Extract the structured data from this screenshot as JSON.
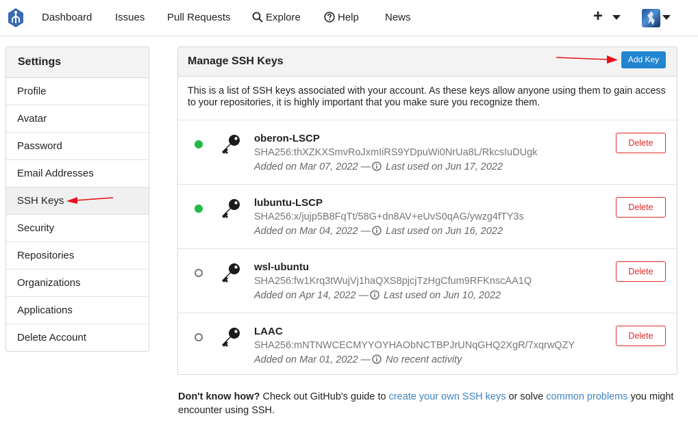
{
  "nav": {
    "items": [
      {
        "label": "Dashboard"
      },
      {
        "label": "Issues"
      },
      {
        "label": "Pull Requests"
      },
      {
        "label": "Explore"
      },
      {
        "label": "Help"
      },
      {
        "label": "News"
      }
    ],
    "plus_label": "+"
  },
  "sidebar": {
    "title": "Settings",
    "items": [
      {
        "label": "Profile"
      },
      {
        "label": "Avatar"
      },
      {
        "label": "Password"
      },
      {
        "label": "Email Addresses"
      },
      {
        "label": "SSH Keys",
        "active": true
      },
      {
        "label": "Security"
      },
      {
        "label": "Repositories"
      },
      {
        "label": "Organizations"
      },
      {
        "label": "Applications"
      },
      {
        "label": "Delete Account"
      }
    ]
  },
  "panel": {
    "title": "Manage SSH Keys",
    "add_key_label": "Add Key",
    "intro": "This is a list of SSH keys associated with your account. As these keys allow anyone using them to gain access to your repositories, it is highly important that you make sure you recognize them.",
    "keys": [
      {
        "name": "oberon-LSCP",
        "fingerprint": "SHA256:thXZKXSmvRoJxmIiRS9YDpuWi0NrUa8L/RkcsIuDUgk",
        "added": "Added on Mar 07, 2022 —",
        "last_used": "Last used on Jun 17, 2022",
        "active": true,
        "delete_label": "Delete"
      },
      {
        "name": "lubuntu-LSCP",
        "fingerprint": "SHA256:x/jujp5B8FqTt/58G+dn8AV+eUvS0qAG/ywzg4fTY3s",
        "added": "Added on Mar 04, 2022 —",
        "last_used": "Last used on Jun 16, 2022",
        "active": true,
        "delete_label": "Delete"
      },
      {
        "name": "wsl-ubuntu",
        "fingerprint": "SHA256:fw1Krq3tWujVj1haQXS8pjcjTzHgCfum9RFKnscAA1Q",
        "added": "Added on Apr 14, 2022 —",
        "last_used": "Last used on Jun 10, 2022",
        "active": false,
        "delete_label": "Delete"
      },
      {
        "name": "LAAC",
        "fingerprint": "SHA256:mNTNWCECMYYOYHAObNCTBPJrUNqGHQ2XgR/7xqrwQZY",
        "added": "Added on Mar 01, 2022 —",
        "last_used": "No recent activity",
        "active": false,
        "delete_label": "Delete"
      }
    ]
  },
  "help": {
    "bold": "Don't know how?",
    "text1": " Check out GitHub's guide to ",
    "link1": "create your own SSH keys",
    "text2": " or solve ",
    "link2": "common problems",
    "text3": " you might encounter using SSH."
  },
  "colors": {
    "accent": "#2185d0",
    "danger": "#db2828",
    "active_dot": "#21ba45",
    "link": "#4183c4",
    "annotation_arrow": "#e8111a"
  }
}
